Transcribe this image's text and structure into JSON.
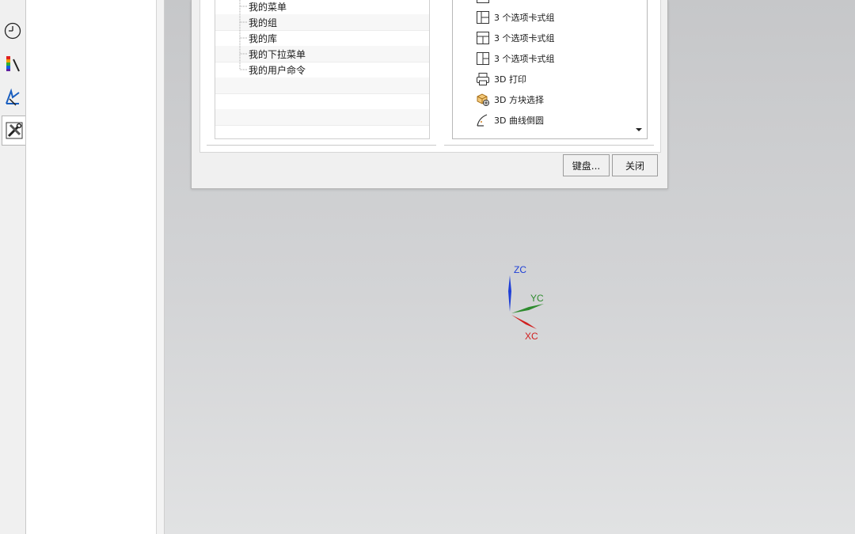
{
  "resource_bar": {
    "items": [
      {
        "name": "history",
        "icon": "clock-icon"
      },
      {
        "name": "palette",
        "icon": "palette-icon"
      },
      {
        "name": "process-studio",
        "icon": "process-studio-icon"
      },
      {
        "name": "roles",
        "icon": "tools-icon",
        "active": true
      }
    ]
  },
  "dialog": {
    "category_tree": {
      "items": [
        "我的菜单",
        "我的组",
        "我的库",
        "我的下拉菜单",
        "我的用户命令"
      ]
    },
    "commands": [
      {
        "label": "3 个选项卡式组",
        "icon": "layout-grid-a-icon"
      },
      {
        "label": "3 个选项卡式组",
        "icon": "layout-grid-b-icon"
      },
      {
        "label": "3 个选项卡式组",
        "icon": "layout-grid-c-icon"
      },
      {
        "label": "3D 打印",
        "icon": "printer-icon"
      },
      {
        "label": "3D 方块选择",
        "icon": "cube-select-icon"
      },
      {
        "label": "3D 曲线倒圆",
        "icon": "curve-fillet-icon"
      }
    ],
    "buttons": {
      "keyboard": "键盘...",
      "close": "关闭"
    }
  },
  "triad": {
    "zc": "ZC",
    "yc": "YC",
    "xc": "XC",
    "colors": {
      "z": "#1f3fd6",
      "y": "#2e8b2e",
      "x": "#d02020"
    }
  }
}
